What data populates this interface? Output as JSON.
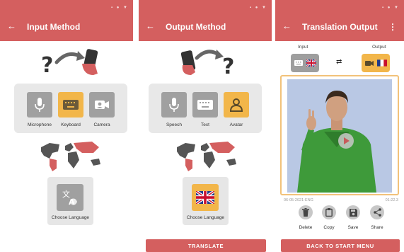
{
  "colors": {
    "accent": "#d45f5f",
    "selected": "#f2b64a",
    "tile": "#a0a0a0"
  },
  "screen1": {
    "title": "Input Method",
    "options": [
      {
        "label": "Microphone",
        "icon": "microphone-icon",
        "selected": false
      },
      {
        "label": "Keyboard",
        "icon": "keyboard-icon",
        "selected": true
      },
      {
        "label": "Camera",
        "icon": "camera-icon",
        "selected": false
      }
    ],
    "choose_language": "Choose Language"
  },
  "screen2": {
    "title": "Output Method",
    "options": [
      {
        "label": "Speech",
        "icon": "microphone-icon",
        "selected": false
      },
      {
        "label": "Text",
        "icon": "keyboard-icon",
        "selected": false
      },
      {
        "label": "Avatar",
        "icon": "avatar-icon",
        "selected": true
      }
    ],
    "choose_language": "Choose Language",
    "translate_button": "TRANSLATE"
  },
  "screen3": {
    "title": "Translation Output",
    "menu": "⋮",
    "input_label": "Input",
    "output_label": "Output",
    "date": "06-05-2021-ENG",
    "duration": "01:22.3",
    "actions": [
      "Delete",
      "Copy",
      "Save",
      "Share"
    ],
    "back_button": "BACK TO START MENU"
  },
  "common": {
    "back_arrow": "←",
    "status_icons": "▪ ● ▼",
    "swap_arrows": "⇄"
  }
}
